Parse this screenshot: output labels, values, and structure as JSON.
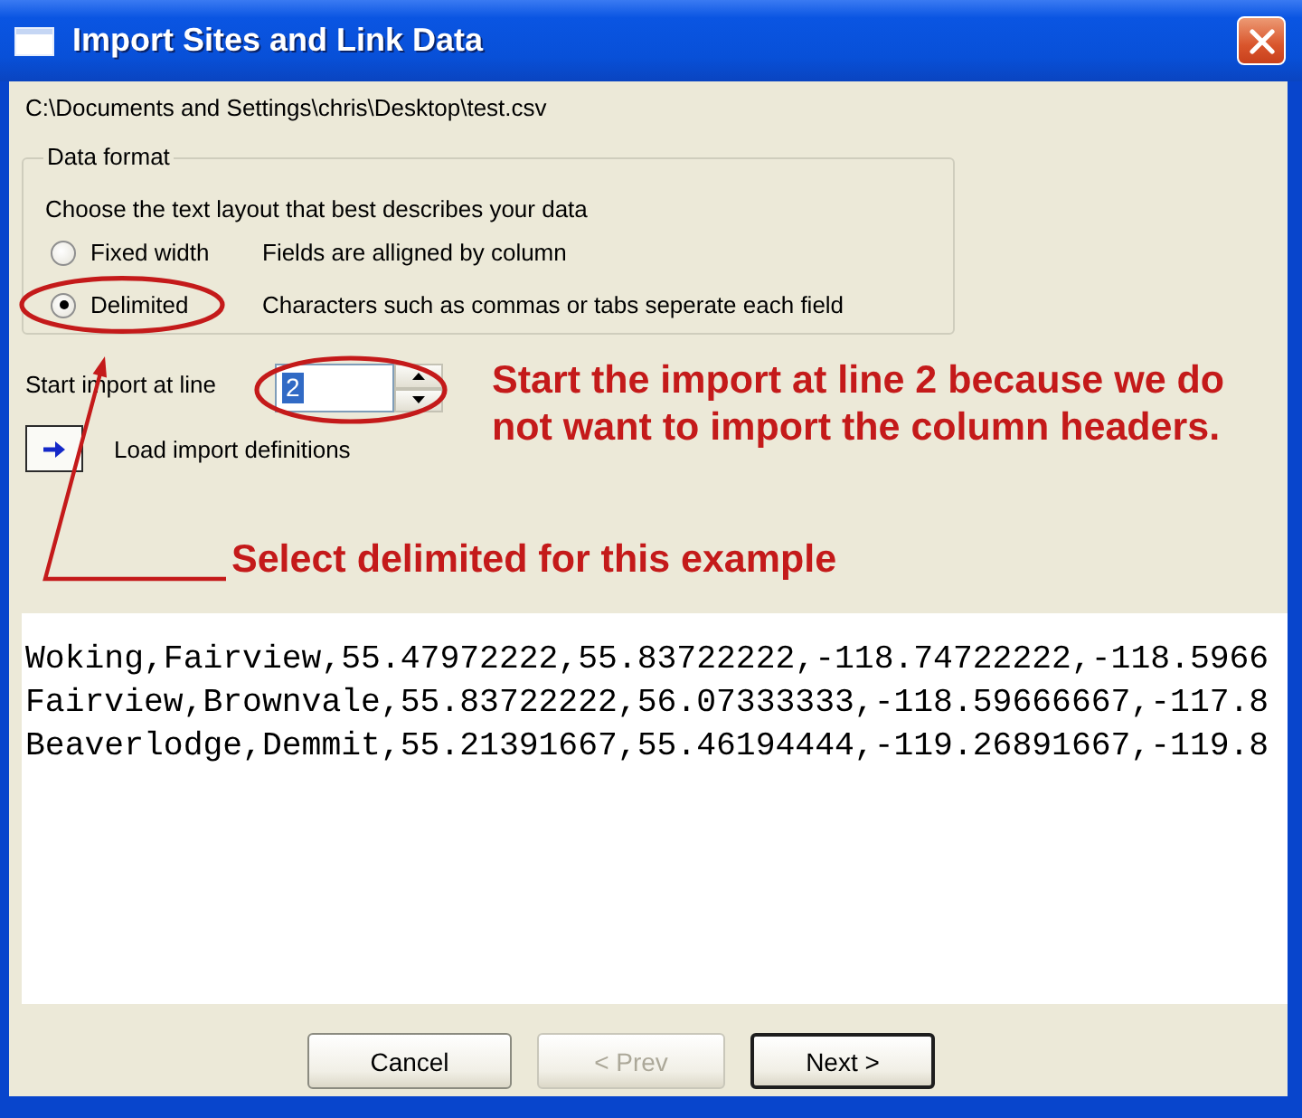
{
  "window": {
    "title": "Import Sites and Link Data"
  },
  "file_path": "C:\\Documents and Settings\\chris\\Desktop\\test.csv",
  "data_format": {
    "legend": "Data format",
    "instruction": "Choose the text layout that best describes your data",
    "options": [
      {
        "label": "Fixed width",
        "description": "Fields are alligned by column",
        "selected": false
      },
      {
        "label": "Delimited",
        "description": "Characters such as commas or tabs seperate each field",
        "selected": true
      }
    ]
  },
  "start_line": {
    "label": "Start import at line",
    "value": "2",
    "value_selected": true
  },
  "load_definitions": {
    "label": "Load import definitions"
  },
  "annotations": [
    {
      "kind": "spinner",
      "text": "Start the import at line 2 because we do not want to import the column headers."
    },
    {
      "kind": "radio",
      "text": "Select delimited for this example"
    }
  ],
  "preview": {
    "lines": [
      "Woking,Fairview,55.47972222,55.83722222,-118.74722222,-118.5966",
      "Fairview,Brownvale,55.83722222,56.07333333,-118.59666667,-117.8",
      "Beaverlodge,Demmit,55.21391667,55.46194444,-119.26891667,-119.8"
    ]
  },
  "buttons": [
    {
      "label": "Cancel",
      "disabled": false,
      "default": false
    },
    {
      "label": "< Prev",
      "disabled": true,
      "default": false
    },
    {
      "label": "Next >",
      "disabled": false,
      "default": true
    }
  ]
}
